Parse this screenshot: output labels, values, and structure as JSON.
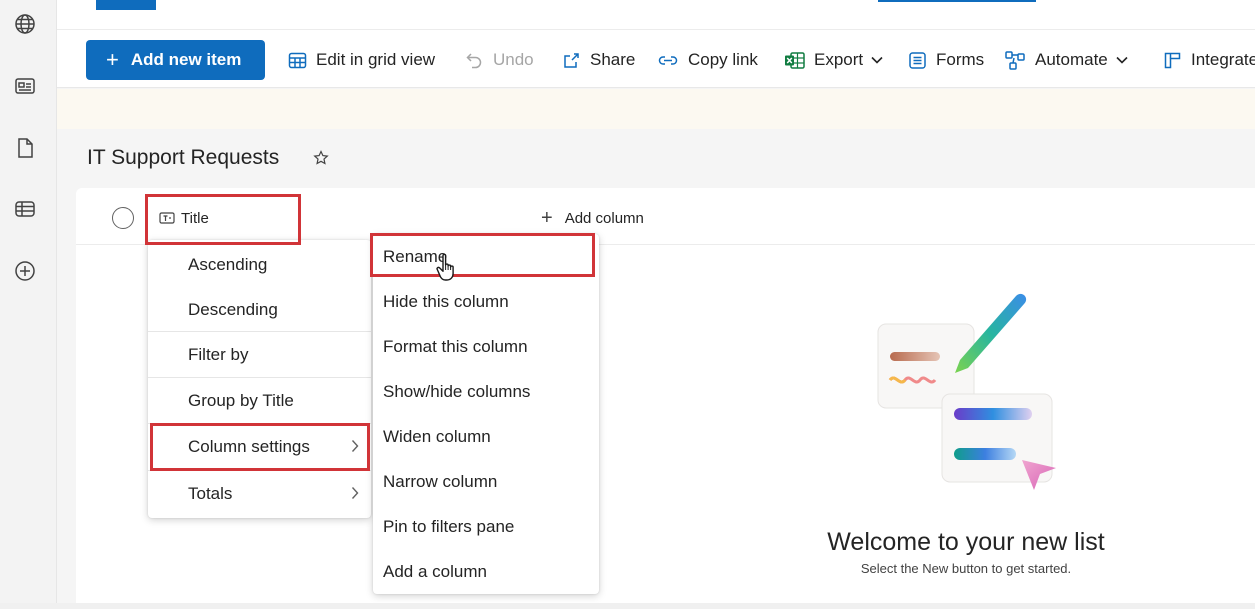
{
  "rail": {
    "items": [
      {
        "icon": "globe-icon"
      },
      {
        "icon": "news-icon"
      },
      {
        "icon": "document-icon"
      },
      {
        "icon": "list-icon"
      },
      {
        "icon": "add-circle-icon"
      }
    ]
  },
  "toolbar": {
    "add_new_item": "Add new item",
    "edit_grid": "Edit in grid view",
    "undo": "Undo",
    "share": "Share",
    "copy_link": "Copy link",
    "export": "Export",
    "forms": "Forms",
    "automate": "Automate",
    "integrate": "Integrate"
  },
  "list": {
    "title": "IT Support Requests",
    "favorite_icon": "star-icon",
    "columns": {
      "title": "Title",
      "add_column": "Add column"
    }
  },
  "column_menu": {
    "items": [
      "Ascending",
      "Descending",
      "Filter by",
      "Group by Title",
      "Column settings",
      "Totals"
    ]
  },
  "column_settings_menu": {
    "items": [
      "Rename",
      "Hide this column",
      "Format this column",
      "Show/hide columns",
      "Widen column",
      "Narrow column",
      "Pin to filters pane",
      "Add a column"
    ]
  },
  "empty_state": {
    "heading": "Welcome to your new list",
    "subtext": "Select the New button to get started."
  },
  "colors": {
    "accent": "#0f6cbd",
    "highlight": "#d13438"
  }
}
